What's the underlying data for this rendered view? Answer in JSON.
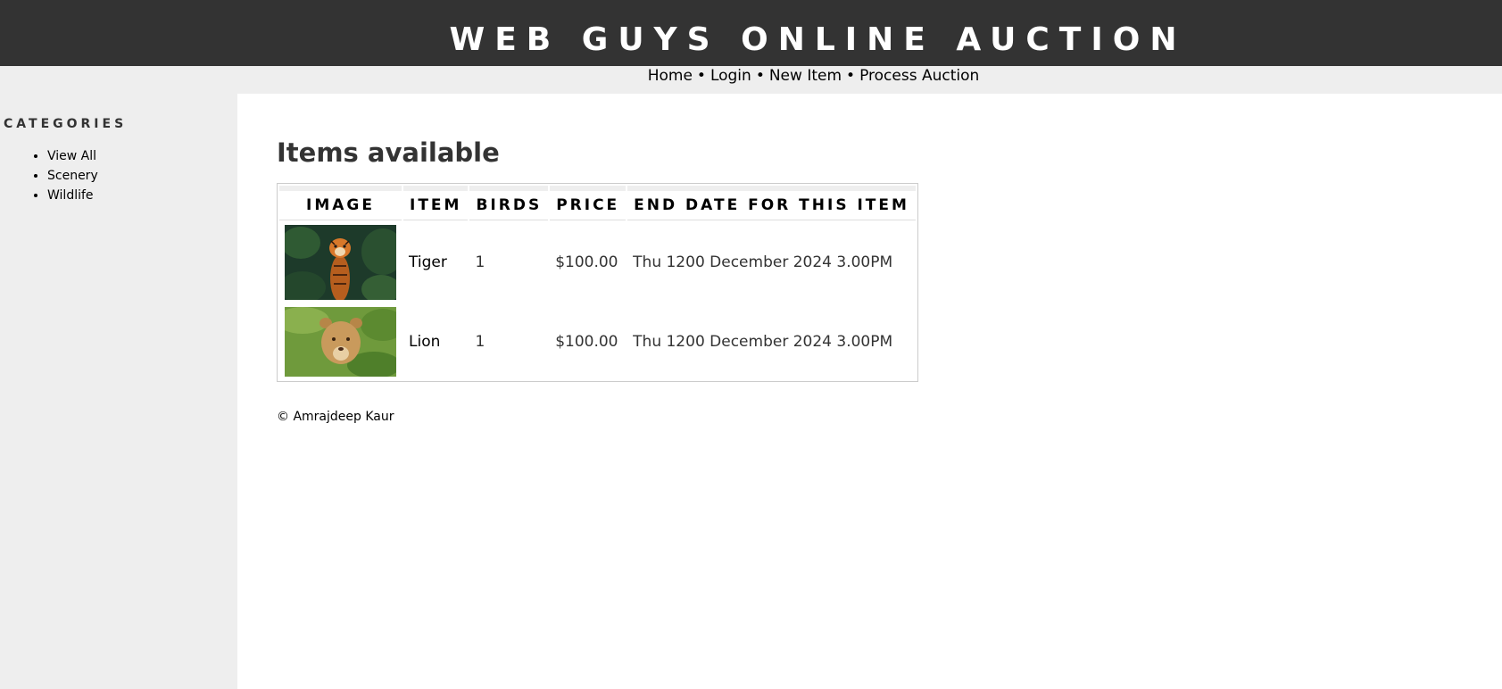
{
  "header": {
    "title": "WEB GUYS ONLINE AUCTION"
  },
  "nav": {
    "items": [
      "Home",
      "Login",
      "New Item",
      "Process Auction"
    ],
    "separator": "•"
  },
  "sidebar": {
    "heading": "CATEGORIES",
    "items": [
      "View All",
      "Scenery",
      "Wildlife"
    ]
  },
  "main": {
    "heading": "Items available",
    "table": {
      "headers": [
        "IMAGE",
        "ITEM",
        "BIRDS",
        "PRICE",
        "END DATE FOR THIS ITEM"
      ],
      "rows": [
        {
          "image": "tiger-photo",
          "item": "Tiger",
          "birds": "1",
          "price": "$100.00",
          "end_date": "Thu 1200 December 2024 3.00PM"
        },
        {
          "image": "lion-cub-photo",
          "item": "Lion",
          "birds": "1",
          "price": "$100.00",
          "end_date": "Thu 1200 December 2024 3.00PM"
        }
      ]
    }
  },
  "footer": {
    "text": "© Amrajdeep Kaur"
  },
  "colors": {
    "header_bg": "#333333",
    "sidebar_bg": "#eeeeee",
    "main_bg": "#ffffff",
    "table_border": "#cccccc"
  }
}
